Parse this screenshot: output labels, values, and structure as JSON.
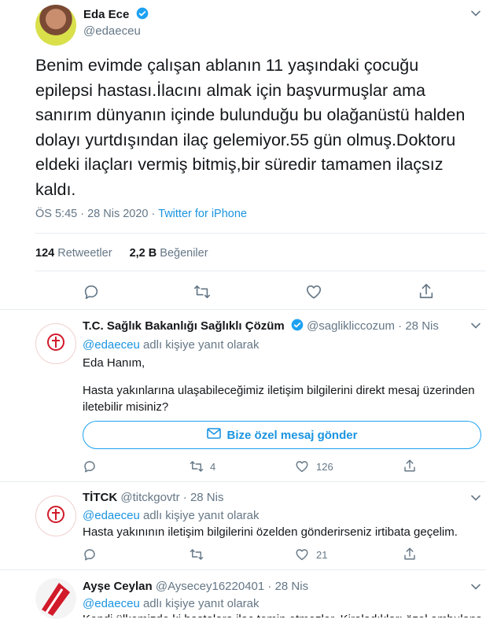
{
  "main_tweet": {
    "author_name": "Eda Ece",
    "author_handle": "@edaeceu",
    "text": "Benim evimde çalışan ablanın 11 yaşındaki çocuğu epilepsi hastası.İlacını almak için başvurmuşlar ama sanırım dünyanın içinde bulunduğu bu olağanüstü halden dolayı yurtdışından ilaç gelemiyor.55 gün olmuş.Doktoru eldeki ilaçları vermiş bitmiş,bir süredir tamamen ilaçsız kaldı.",
    "time": "ÖS 5:45",
    "date": "28 Nis 2020",
    "dot": "·",
    "source": "Twitter for iPhone",
    "retweets_count": "124",
    "retweets_label": "Retweetler",
    "likes_count": "2,2 B",
    "likes_label": "Beğeniler"
  },
  "replies": [
    {
      "author_name": "T.C. Sağlık Bakanlığı Sağlıklı Çözüm",
      "author_handle": "@saglikliccozum",
      "dot": "·",
      "date": "28 Nis",
      "reply_to_handle": "@edaeceu",
      "reply_to_suffix": "adlı kişiye yanıt olarak",
      "line1": "Eda Hanım,",
      "line2": "Hasta yakınlarına ulaşabileceğimiz iletişim bilgilerini direkt mesaj üzerinden iletebilir misiniz?",
      "dm_button": "Bize özel mesaj gönder",
      "retweets": "4",
      "likes": "126"
    },
    {
      "author_name": "TİTCK",
      "author_handle": "@titckgovtr",
      "dot": "·",
      "date": "28 Nis",
      "reply_to_handle": "@edaeceu",
      "reply_to_suffix": "adlı kişiye yanıt olarak",
      "text": "Hasta yakınının iletişim bilgilerini özelden gönderirseniz irtibata geçelim.",
      "retweets": "",
      "likes": "21"
    },
    {
      "author_name": "Ayşe Ceylan",
      "author_handle": "@Aysecey16220401",
      "dot": "·",
      "date": "28 Nis",
      "reply_to_handle": "@edaeceu",
      "reply_to_suffix": "adlı kişiye yanıt olarak",
      "text": "Kendi ülkemizde ki hastalara ilaç temin etmezler. Kiraladıkları özel ambulans"
    }
  ],
  "colors": {
    "accent": "#1da1f2",
    "muted": "#657786",
    "divider": "#e6ecf0"
  }
}
